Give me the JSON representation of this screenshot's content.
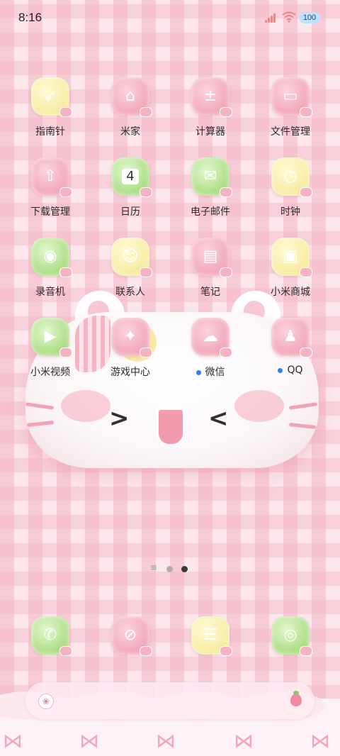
{
  "status_bar": {
    "time": "8:16",
    "battery": "100",
    "signal_icon": "cellular-signal-icon",
    "wifi_icon": "wifi-icon"
  },
  "apps": [
    {
      "label": "指南针",
      "icon": "compass-icon",
      "glyph": "➹",
      "theme": "yellow"
    },
    {
      "label": "米家",
      "icon": "mi-home-icon",
      "glyph": "⌂",
      "theme": "pink"
    },
    {
      "label": "计算器",
      "icon": "calculator-icon",
      "glyph": "±",
      "theme": "pink"
    },
    {
      "label": "文件管理",
      "icon": "folder-icon",
      "glyph": "▭",
      "theme": "pink"
    },
    {
      "label": "下载管理",
      "icon": "download-cloud-icon",
      "glyph": "⇧",
      "theme": "pink"
    },
    {
      "label": "日历",
      "icon": "calendar-icon",
      "glyph": "4",
      "theme": "green"
    },
    {
      "label": "电子邮件",
      "icon": "mail-icon",
      "glyph": "✉",
      "theme": "green"
    },
    {
      "label": "时钟",
      "icon": "clock-icon",
      "glyph": "◷",
      "theme": "yellow"
    },
    {
      "label": "录音机",
      "icon": "recorder-icon",
      "glyph": "◉",
      "theme": "green"
    },
    {
      "label": "联系人",
      "icon": "contacts-icon",
      "glyph": "☺",
      "theme": "yellow"
    },
    {
      "label": "笔记",
      "icon": "notes-icon",
      "glyph": "▤",
      "theme": "pink"
    },
    {
      "label": "小米商城",
      "icon": "mi-store-icon",
      "glyph": "▣",
      "theme": "yellow"
    },
    {
      "label": "小米视频",
      "icon": "video-play-icon",
      "glyph": "▶",
      "theme": "green"
    },
    {
      "label": "游戏中心",
      "icon": "game-center-icon",
      "glyph": "✦",
      "theme": "pink"
    },
    {
      "label": "微信",
      "icon": "wechat-icon",
      "glyph": "☁",
      "theme": "pink",
      "new": true
    },
    {
      "label": "QQ",
      "icon": "qq-penguin-icon",
      "glyph": "♟",
      "theme": "pink",
      "new": true
    }
  ],
  "page_indicator": {
    "menu_icon": "≡",
    "pages": 2,
    "active_page": 2
  },
  "dock": [
    {
      "icon": "phone-icon",
      "glyph": "✆",
      "theme": "green"
    },
    {
      "icon": "browser-icon",
      "glyph": "⊘",
      "theme": "pink"
    },
    {
      "icon": "messages-icon",
      "glyph": "☰",
      "theme": "yellow"
    },
    {
      "icon": "camera-icon",
      "glyph": "◎",
      "theme": "green"
    }
  ],
  "search_bar": {
    "left_icon": "paw-icon",
    "right_icon": "strawberry-icon"
  }
}
